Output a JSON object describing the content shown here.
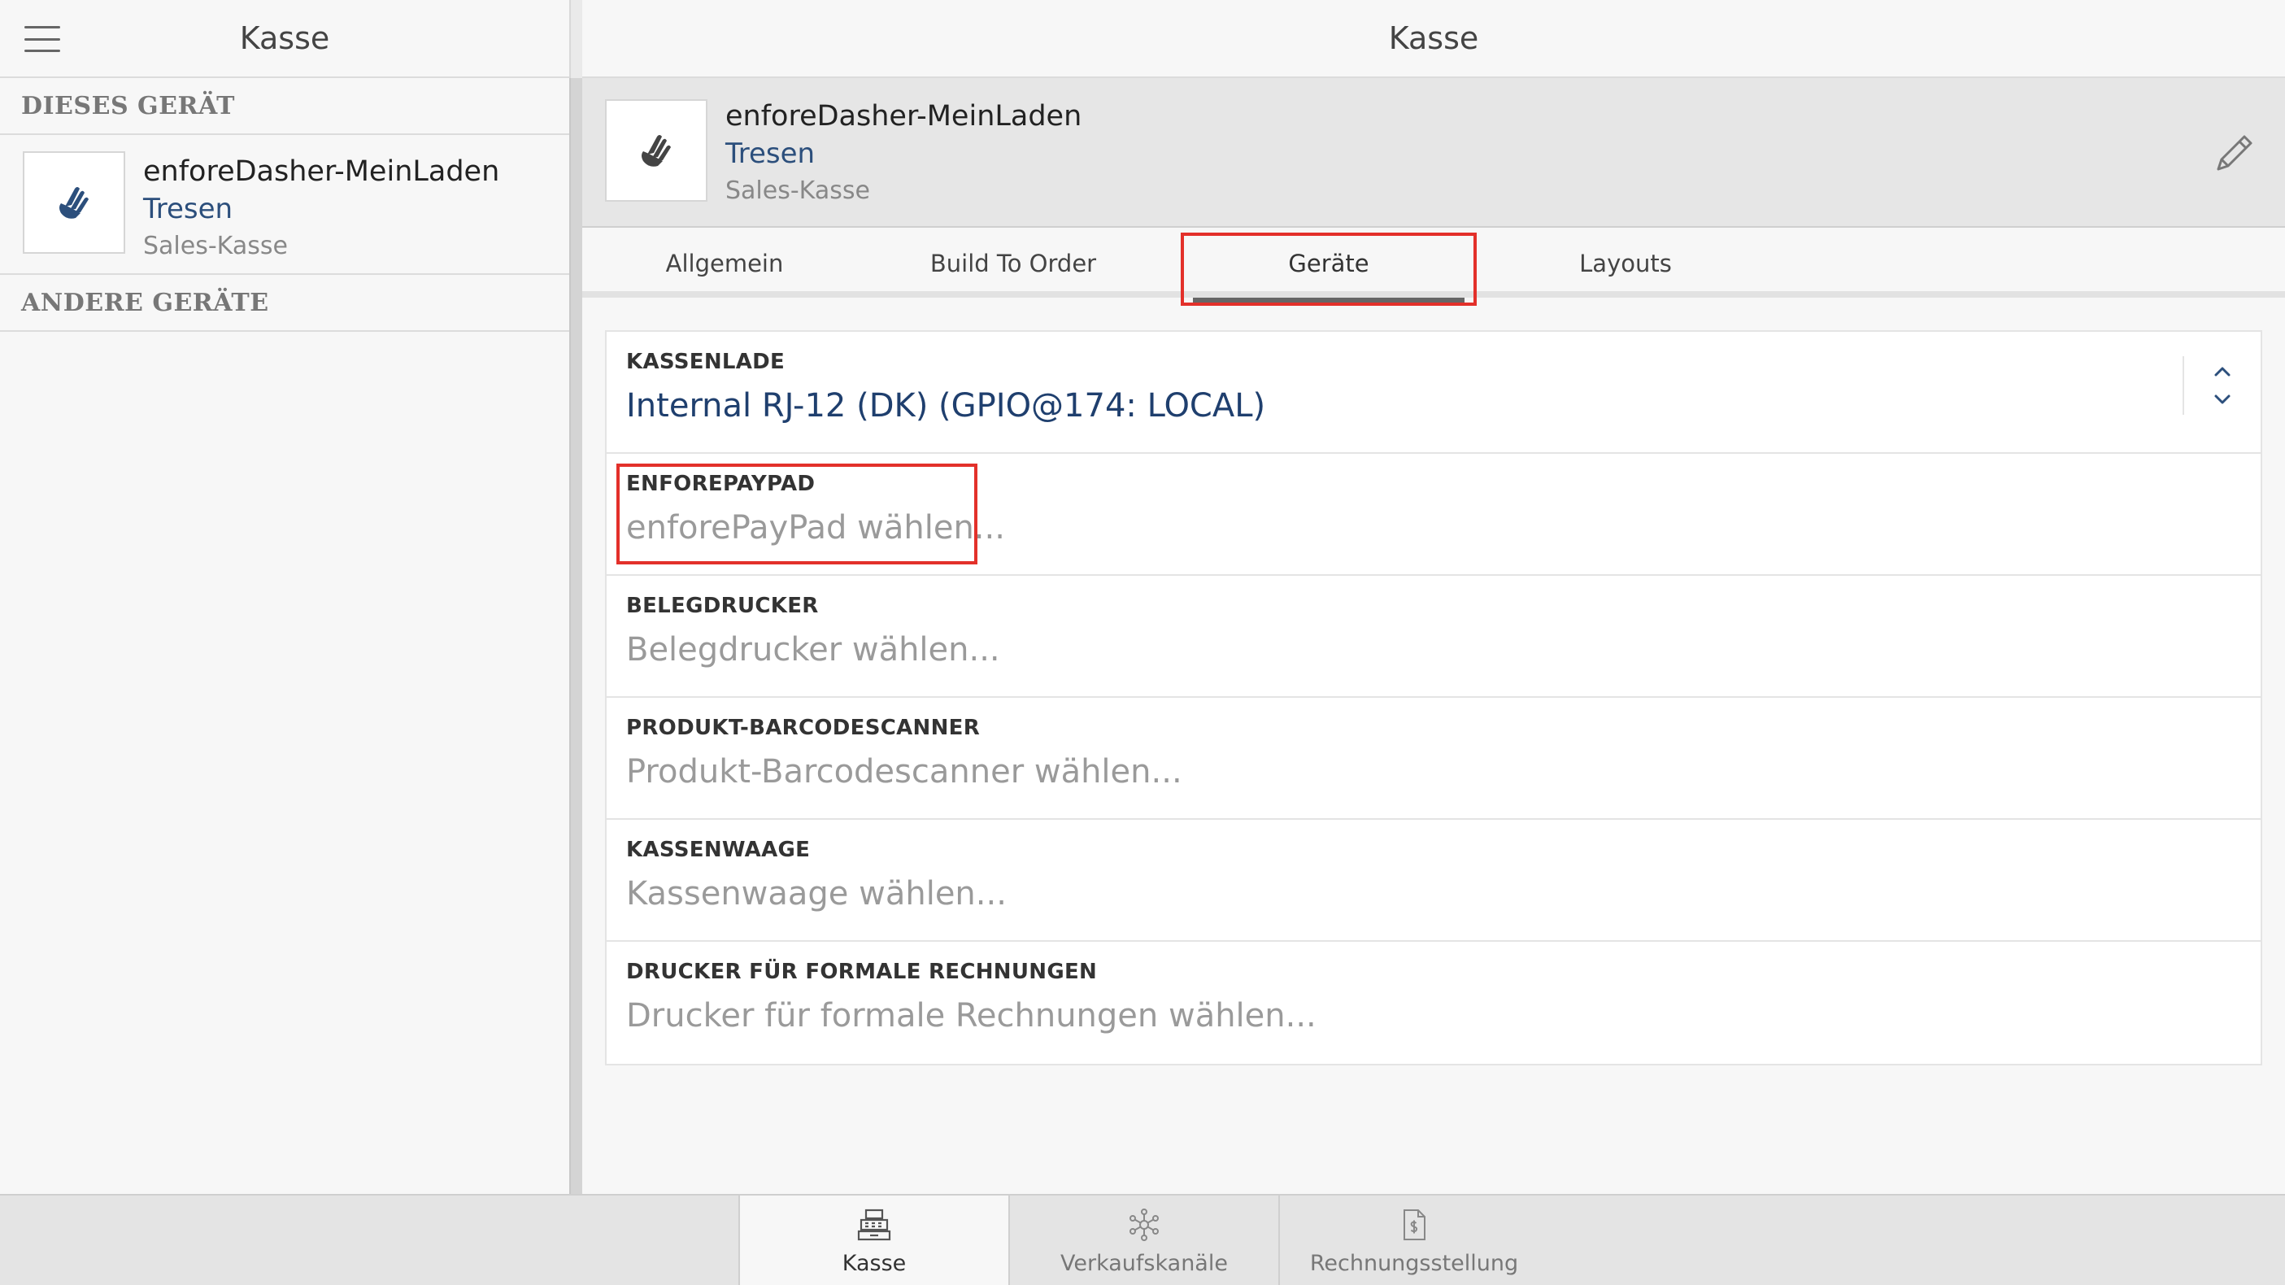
{
  "left": {
    "title": "Kasse",
    "section_this_device": "DIESES GERÄT",
    "section_other_devices": "ANDERE GERÄTE",
    "device": {
      "name": "enforeDasher-MeinLaden",
      "location": "Tresen",
      "type": "Sales-Kasse",
      "icon": "hand-icon"
    }
  },
  "right": {
    "title": "Kasse",
    "device": {
      "name": "enforeDasher-MeinLaden",
      "location": "Tresen",
      "type": "Sales-Kasse",
      "icon": "hand-icon"
    },
    "edit_icon": "pencil-icon",
    "tabs": [
      {
        "label": "Allgemein",
        "active": false
      },
      {
        "label": "Build To Order",
        "active": false
      },
      {
        "label": "Geräte",
        "active": true
      },
      {
        "label": "Layouts",
        "active": false
      }
    ],
    "fields": [
      {
        "label": "KASSENLADE",
        "value": "Internal RJ-12 (DK) (GPIO@174: LOCAL)",
        "is_placeholder": false
      },
      {
        "label": "ENFOREPAYPAD",
        "value": "enforePayPad wählen...",
        "is_placeholder": true
      },
      {
        "label": "BELEGDRUCKER",
        "value": "Belegdrucker wählen...",
        "is_placeholder": true
      },
      {
        "label": "PRODUKT-BARCODESCANNER",
        "value": "Produkt-Barcodescanner wählen...",
        "is_placeholder": true
      },
      {
        "label": "KASSENWAAGE",
        "value": "Kassenwaage wählen...",
        "is_placeholder": true
      },
      {
        "label": "DRUCKER FÜR FORMALE RECHNUNGEN",
        "value": "Drucker für formale Rechnungen wählen...",
        "is_placeholder": true
      }
    ]
  },
  "bottom_nav": [
    {
      "label": "Kasse",
      "icon": "cash-register-icon",
      "active": true
    },
    {
      "label": "Verkaufskanäle",
      "icon": "network-icon",
      "active": false
    },
    {
      "label": "Rechnungsstellung",
      "icon": "invoice-icon",
      "active": false
    }
  ],
  "colors": {
    "accent_blue": "#1f3f6e",
    "highlight_red": "#e3302a",
    "background": "#f7f7f7"
  }
}
